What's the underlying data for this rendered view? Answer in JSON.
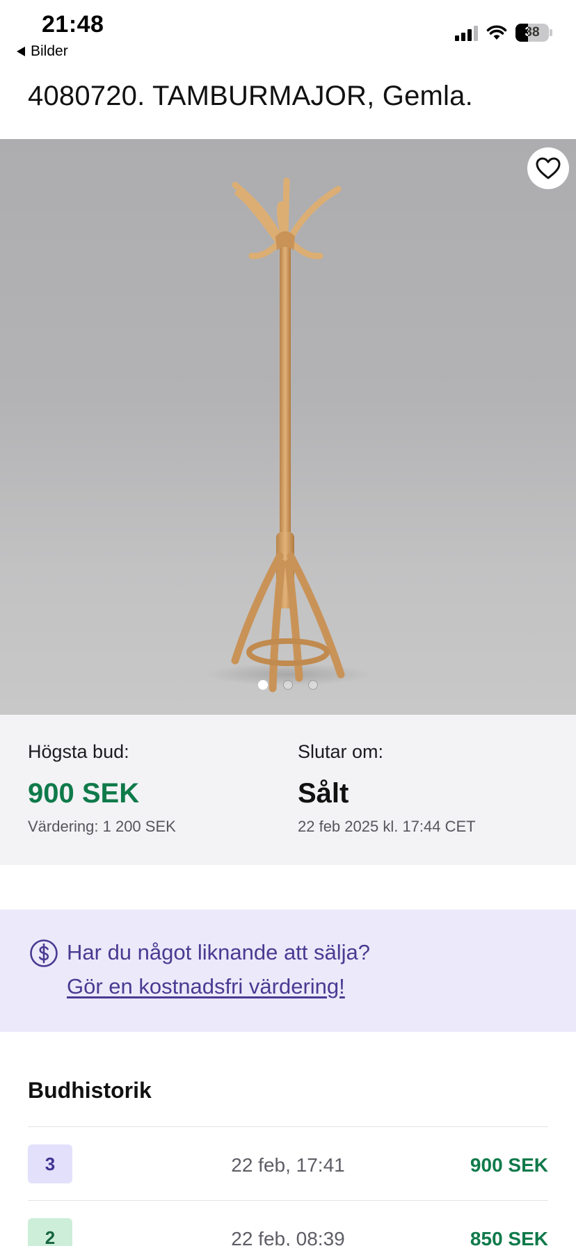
{
  "status_bar": {
    "time": "21:48",
    "back_label": "Bilder",
    "battery_level": "38",
    "icons": [
      "cellular-signal-icon",
      "wifi-icon",
      "battery-icon"
    ]
  },
  "item": {
    "title": "4080720. TAMBURMAJOR, Gemla."
  },
  "gallery": {
    "image_count": 3,
    "active_index": 0,
    "favorite_icon": "heart-outline-icon"
  },
  "bid_info": {
    "highest_bid_label": "Högsta bud:",
    "highest_bid_value": "900 SEK",
    "valuation": "Värdering: 1 200 SEK",
    "ends_label": "Slutar om:",
    "ends_status": "Sålt",
    "end_time": "22 feb 2025 kl. 17:44 CET"
  },
  "promo": {
    "icon": "dollar-circle-icon",
    "question": "Har du något liknande att sälja?",
    "link": "Gör en kostnadsfri värdering!"
  },
  "bid_history": {
    "title": "Budhistorik",
    "rows": [
      {
        "number": "3",
        "date": "22 feb, 17:41",
        "amount": "900 SEK"
      },
      {
        "number": "2",
        "date": "22 feb, 08:39",
        "amount": "850 SEK"
      }
    ]
  },
  "colors": {
    "accent_green": "#0f7a4a",
    "accent_purple": "#4a3a92",
    "promo_background": "#ece9fa",
    "bid_box_background": "#f3f3f6"
  }
}
